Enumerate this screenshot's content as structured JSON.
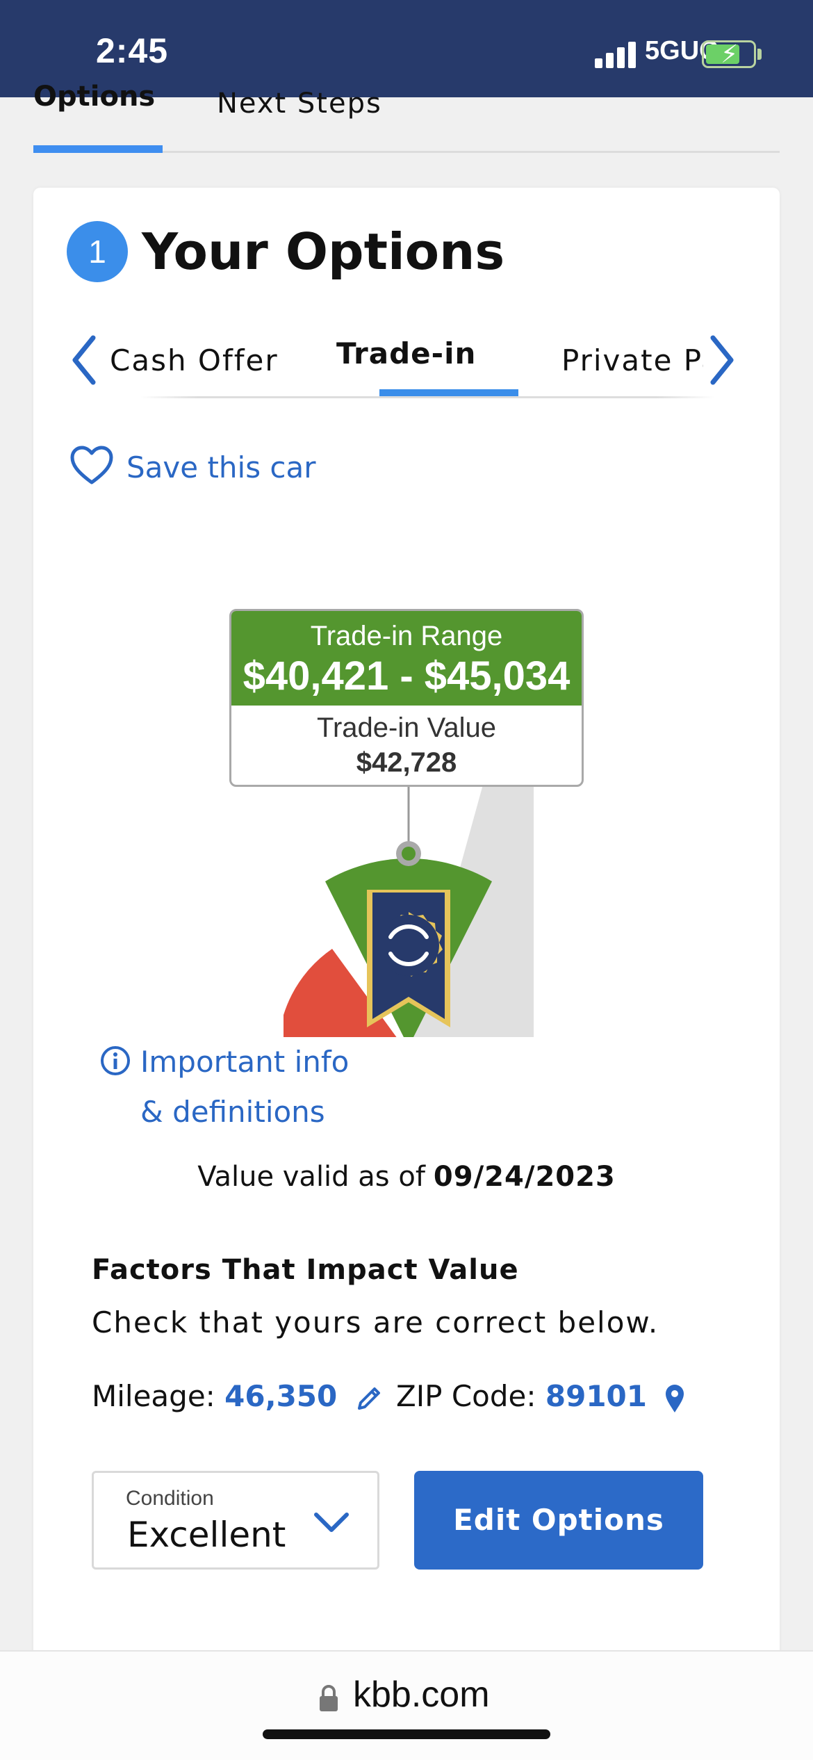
{
  "status_bar": {
    "time": "2:45",
    "network": "5GUC"
  },
  "section_tabs": {
    "options": "Options",
    "next_steps": "Next Steps"
  },
  "card": {
    "step_number": "1",
    "title": "Your Options",
    "option_tabs": [
      "Cash Offer",
      "Trade-in",
      "Private Party"
    ],
    "active_tab": "Trade-in",
    "save_car": "Save this car",
    "value_box": {
      "range_label": "Trade-in Range",
      "range": "$40,421 - $45,034",
      "value_label": "Trade-in Value",
      "value": "$42,728"
    },
    "gauge_colors": {
      "low": "#e14e3d",
      "fair": "#54962f",
      "high": "#e0e0e0"
    },
    "info_link_line1": "Important info",
    "info_link_line2": "& definitions",
    "valid_label": "Value valid as of",
    "valid_date": "09/24/2023",
    "factors_title": "Factors That Impact Value",
    "factors_subtitle": "Check that yours are correct below.",
    "mileage_label": "Mileage:",
    "mileage_value": "46,350",
    "zip_label": "ZIP Code:",
    "zip_value": "89101",
    "condition_label": "Condition",
    "condition_value": "Excellent",
    "edit_button": "Edit Options"
  },
  "url_bar": {
    "url": "kbb.com"
  },
  "colors": {
    "brand_navy": "#273a6b",
    "accent_blue": "#2c6ac8",
    "green": "#54962f"
  }
}
